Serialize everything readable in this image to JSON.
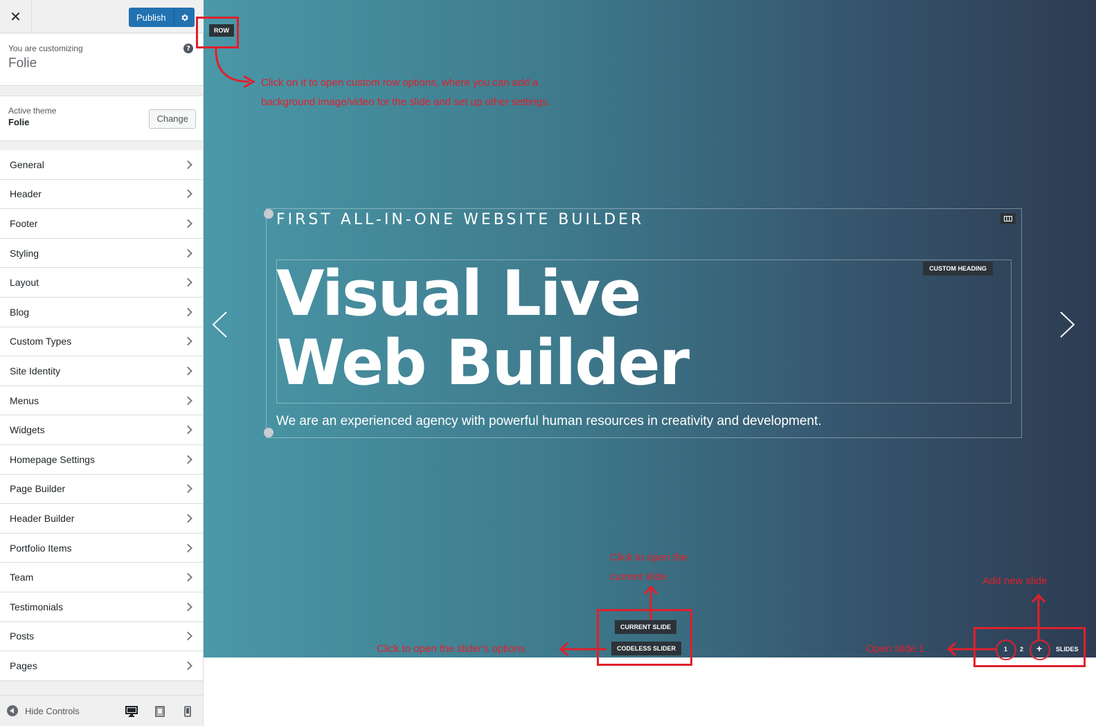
{
  "sidebar": {
    "close_icon": "close-icon",
    "publish_label": "Publish",
    "settings_icon": "gear-icon",
    "customizing_label": "You are customizing",
    "site_name": "Folie",
    "help_icon": "?",
    "active_theme_label": "Active theme",
    "active_theme_name": "Folie",
    "change_label": "Change",
    "menu": [
      "General",
      "Header",
      "Footer",
      "Styling",
      "Layout",
      "Blog",
      "Custom Types",
      "Site Identity",
      "Menus",
      "Widgets",
      "Homepage Settings",
      "Page Builder",
      "Header Builder",
      "Portfolio Items",
      "Team",
      "Testimonials",
      "Posts",
      "Pages"
    ],
    "hide_controls_label": "Hide Controls"
  },
  "preview": {
    "row_badge": "ROW",
    "eyebrow": "FIRST ALL-IN-ONE WEBSITE BUILDER",
    "heading_badge": "CUSTOM HEADING",
    "heading_line1": "Visual Live",
    "heading_line2": "Web Builder",
    "subtext": "We are an experienced agency with powerful human resources in creativity and development.",
    "current_slide": "CURRENT SLIDE",
    "codeless_slider": "CODELESS SLIDER",
    "slide_1": "1",
    "slide_2": "2",
    "add_slide": "+",
    "slides_label": "SLIDES"
  },
  "annotations": {
    "row_line1": "Click on it to open custom row options, where you can add a",
    "row_line2": "background image/video for the slide and set up other settings.",
    "current_line1": "Click to open the",
    "current_line2": "current slide",
    "slider_options": "Click to open the slider's options",
    "add_new_slide": "Add new slide",
    "open_slide_1": "Open slide 1"
  },
  "colors": {
    "accent": "#2271b1",
    "annotation_red": "#e0202c",
    "badge_dark": "#2c3338"
  }
}
